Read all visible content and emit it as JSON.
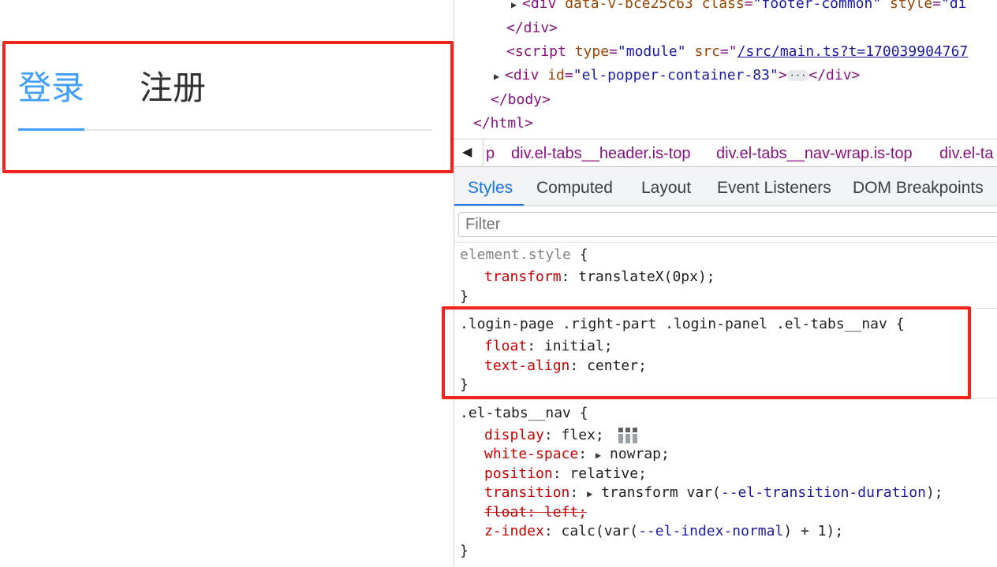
{
  "login_panel": {
    "tabs": [
      {
        "label": "登录",
        "active": true
      },
      {
        "label": "注册",
        "active": false
      }
    ],
    "accent_color": "#409eff",
    "highlight_color": "#f1231c"
  },
  "devtools": {
    "dom_lines": {
      "l1_tag_open": "<div",
      "l1_attr1_name": "data-v-bce25c63",
      "l1_attr2_name": "class",
      "l1_attr2_val": "\"footer-common\"",
      "l1_attr3_name": "style",
      "l1_attr3_val": "\"di",
      "l2": "</div>",
      "l3_tag_open": "<script",
      "l3_attr1_name": "type",
      "l3_attr1_val": "\"module\"",
      "l3_attr2_name": "src",
      "l3_attr2_val": "/src/main.ts?t=170039904767",
      "l4_tag_open": "<div",
      "l4_attr_name": "id",
      "l4_attr_val": "\"el-popper-container-83\"",
      "l4_close": "</div>",
      "l4_ellipsis": "···",
      "l5": "</body>",
      "l6": "</html>"
    },
    "breadcrumbs": [
      "div.el-tabs__header.is-top",
      "div.el-tabs__nav-wrap.is-top",
      "div.el-ta"
    ],
    "breadcrumb_prefix": "p",
    "panel_tabs": [
      "Styles",
      "Computed",
      "Layout",
      "Event Listeners",
      "DOM Breakpoints"
    ],
    "active_panel_tab": "Styles",
    "filter_placeholder": "Filter",
    "rules": {
      "r1_selector": "element.style",
      "r1_p1_name": "transform",
      "r1_p1_val": "translateX(0px);",
      "r2_selector": ".login-page .right-part .login-panel .el-tabs__nav",
      "r2_p1_name": "float",
      "r2_p1_val": "initial;",
      "r2_p2_name": "text-align",
      "r2_p2_val": "center;",
      "r3_selector": ".el-tabs__nav",
      "r3_p1_name": "display",
      "r3_p1_val": "flex;",
      "r3_p2_name": "white-space",
      "r3_p2_val": "nowrap;",
      "r3_p3_name": "position",
      "r3_p3_val": "relative;",
      "r3_p4_name": "transition",
      "r3_p4_val_a": "transform var(",
      "r3_p4_val_var": "--el-transition-duration",
      "r3_p4_val_b": ");",
      "r3_p5_text": "float: left;",
      "r3_p6_name": "z-index",
      "r3_p6_val_a": "calc(var(",
      "r3_p6_val_var": "--el-index-normal",
      "r3_p6_val_b": ") + 1);"
    }
  }
}
